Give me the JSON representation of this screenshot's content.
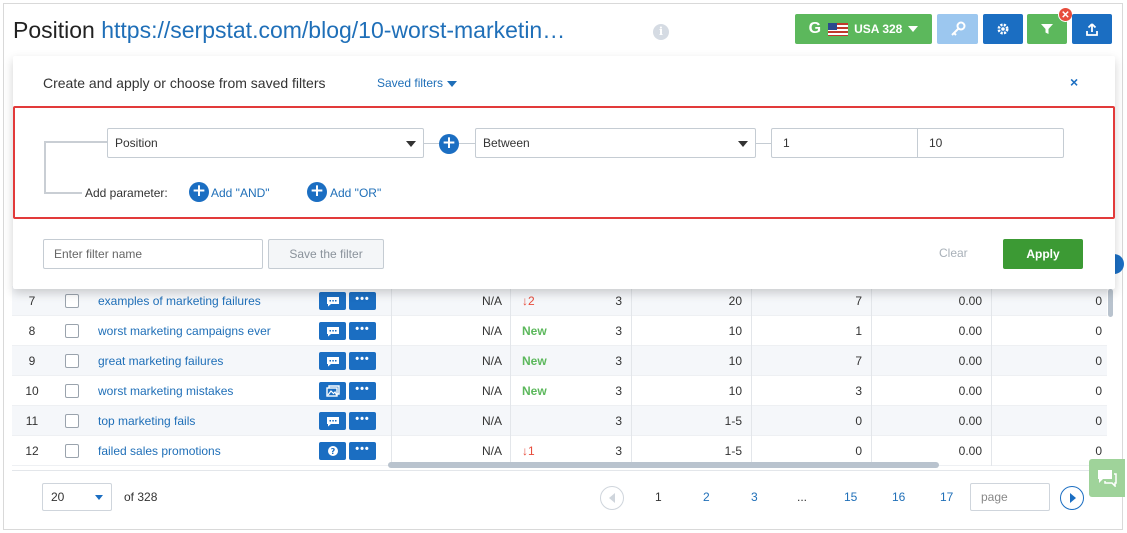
{
  "header": {
    "title_prefix": "Position",
    "title_url": "https://serpstat.com/blog/10-worst-marketin…",
    "info_icon": "i",
    "db_label": "USA 328",
    "db_brand": "G"
  },
  "filter_panel": {
    "title": "Create and apply or choose from saved filters",
    "saved_filters_label": "Saved filters",
    "close": "×",
    "parameter": "Position",
    "condition": "Between",
    "value_from": "1",
    "value_to": "10",
    "add_parameter_label": "Add parameter:",
    "add_and": "Add \"AND\"",
    "add_or": "Add \"OR\"",
    "filter_name_placeholder": "Enter filter name",
    "save_filter": "Save the filter",
    "clear": "Clear",
    "apply": "Apply"
  },
  "table": {
    "rows": [
      {
        "num": "7",
        "keyword": "examples of marketing failures",
        "na": "N/A",
        "dyn": "↓2",
        "dyn_type": "down",
        "n3": "3",
        "vol": "20",
        "cmp": "7",
        "cpc": "0.00",
        "last": "0"
      },
      {
        "num": "8",
        "keyword": "worst marketing campaigns ever",
        "na": "N/A",
        "dyn": "New",
        "dyn_type": "new",
        "n3": "3",
        "vol": "10",
        "cmp": "1",
        "cpc": "0.00",
        "last": "0"
      },
      {
        "num": "9",
        "keyword": "great marketing failures",
        "na": "N/A",
        "dyn": "New",
        "dyn_type": "new",
        "n3": "3",
        "vol": "10",
        "cmp": "7",
        "cpc": "0.00",
        "last": "0"
      },
      {
        "num": "10",
        "keyword": "worst marketing mistakes",
        "na": "N/A",
        "dyn": "New",
        "dyn_type": "new",
        "n3": "3",
        "vol": "10",
        "cmp": "3",
        "cpc": "0.00",
        "last": "0"
      },
      {
        "num": "11",
        "keyword": "top marketing fails",
        "na": "N/A",
        "dyn": "",
        "dyn_type": "none",
        "n3": "3",
        "vol": "1-5",
        "cmp": "0",
        "cpc": "0.00",
        "last": "0"
      },
      {
        "num": "12",
        "keyword": "failed sales promotions",
        "na": "N/A",
        "dyn": "↓1",
        "dyn_type": "down",
        "n3": "3",
        "vol": "1-5",
        "cmp": "0",
        "cpc": "0.00",
        "last": "0"
      }
    ],
    "more_label": "•••"
  },
  "pagination": {
    "per_page": "20",
    "of_total": "of 328",
    "pages": [
      "1",
      "2",
      "3",
      "...",
      "15",
      "16",
      "17"
    ],
    "current_page": "1",
    "page_placeholder": "page"
  },
  "colors": {
    "accent_blue": "#1b6ec2",
    "success_green": "#5cb85c",
    "apply_green": "#3c9a34",
    "error_red": "#e23a3a"
  }
}
